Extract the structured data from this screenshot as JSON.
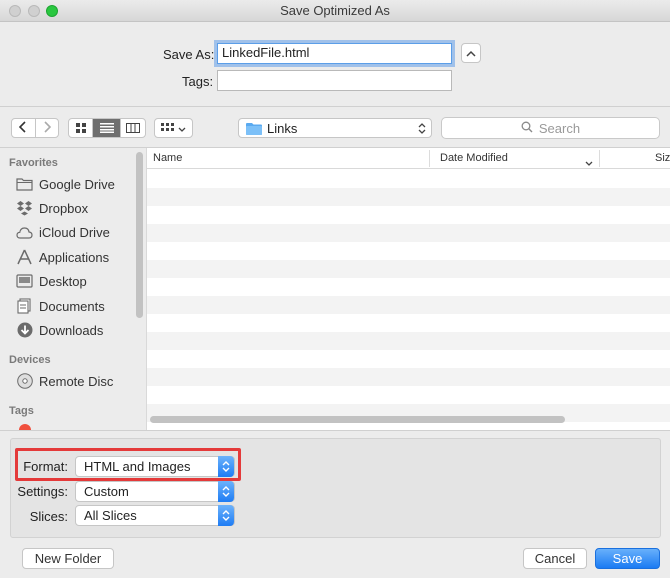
{
  "window": {
    "title": "Save Optimized As"
  },
  "save": {
    "save_as_label": "Save As:",
    "filename": "LinkedFile.html",
    "tags_label": "Tags:",
    "tags_value": ""
  },
  "toolbar": {
    "location": "Links",
    "search_placeholder": "Search"
  },
  "sidebar": {
    "favorites_header": "Favorites",
    "favorites": [
      {
        "label": "Google Drive",
        "icon": "folder-icon"
      },
      {
        "label": "Dropbox",
        "icon": "dropbox-icon"
      },
      {
        "label": "iCloud Drive",
        "icon": "cloud-icon"
      },
      {
        "label": "Applications",
        "icon": "applications-icon"
      },
      {
        "label": "Desktop",
        "icon": "desktop-icon"
      },
      {
        "label": "Documents",
        "icon": "documents-icon"
      },
      {
        "label": "Downloads",
        "icon": "downloads-icon"
      }
    ],
    "devices_header": "Devices",
    "devices": [
      {
        "label": "Remote Disc",
        "icon": "disc-icon"
      }
    ],
    "tags_header": "Tags"
  },
  "file_list": {
    "columns": [
      "Name",
      "Date Modified",
      "Siz"
    ]
  },
  "options": {
    "format_label": "Format:",
    "format_value": "HTML and Images",
    "settings_label": "Settings:",
    "settings_value": "Custom",
    "slices_label": "Slices:",
    "slices_value": "All Slices"
  },
  "buttons": {
    "new_folder": "New Folder",
    "cancel": "Cancel",
    "save": "Save"
  },
  "colors": {
    "accent": "#1b7bf3",
    "highlight_box": "#e43a3a",
    "window_bg": "#ececec"
  }
}
